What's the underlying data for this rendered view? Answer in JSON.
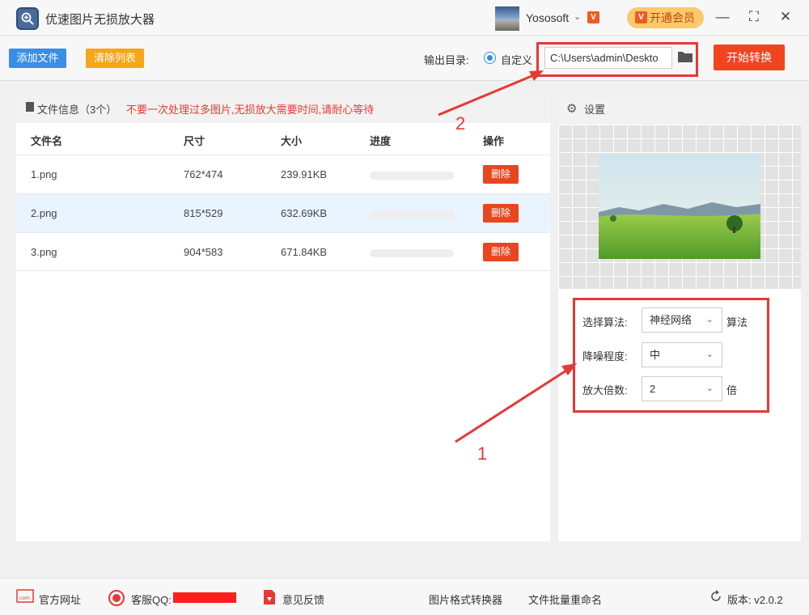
{
  "app": {
    "title": "优速图片无损放大器"
  },
  "account": {
    "name": "Yososoft",
    "vip_label": "开通会员",
    "vip_icon": "V",
    "dropdown_icon": "chevron-down-icon"
  },
  "window": {
    "min": "—",
    "max": "⛶",
    "close": "✕"
  },
  "toolbar": {
    "add_label": "添加文件",
    "clear_label": "清除列表",
    "output_label": "输出目录:",
    "custom_label": "自定义",
    "path_value": "C:\\Users\\admin\\Deskto",
    "start_label": "开始转换"
  },
  "files": {
    "header_title": "文件信息（3个）",
    "warning": "不要一次处理过多图片,无损放大需要时间,请耐心等待",
    "columns": [
      "文件名",
      "尺寸",
      "大小",
      "进度",
      "操作"
    ],
    "rows": [
      {
        "name": "1.png",
        "size": "762*474",
        "bytes": "239.91KB",
        "progress": 0,
        "action": "删除"
      },
      {
        "name": "2.png",
        "size": "815*529",
        "bytes": "632.69KB",
        "progress": 0,
        "action": "删除"
      },
      {
        "name": "3.png",
        "size": "904*583",
        "bytes": "671.84KB",
        "progress": 0,
        "action": "删除"
      }
    ]
  },
  "settings": {
    "title": "设置",
    "algorithm_label": "选择算法:",
    "algorithm_value": "神经网络",
    "algorithm_suffix": "算法",
    "noise_label": "降噪程度:",
    "noise_value": "中",
    "scale_label": "放大倍数:",
    "scale_value": "2",
    "scale_suffix": "倍"
  },
  "annotations": {
    "one": "1",
    "two": "2",
    "color": "#e53935"
  },
  "footer": {
    "website": "官方网址",
    "qq": "客服QQ:",
    "feedback": "意见反馈",
    "converter": "图片格式转换器",
    "renamer": "文件批量重命名",
    "version": "版本: v2.0.2"
  },
  "colors": {
    "primary": "#3a8ee6",
    "danger": "#f0441f",
    "orange": "#f7a51a"
  }
}
